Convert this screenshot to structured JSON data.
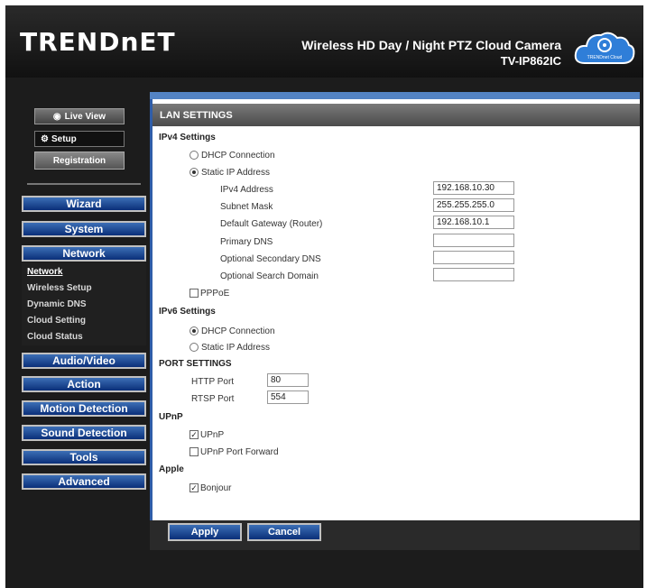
{
  "header": {
    "logo": "TRENDnET",
    "product_title": "Wireless HD Day / Night PTZ Cloud Camera",
    "model": "TV-IP862IC",
    "cloud_label": "TRENDnet Cloud"
  },
  "sidebar": {
    "live_view": "Live View",
    "setup": "Setup",
    "registration": "Registration",
    "nav": [
      "Wizard",
      "System",
      "Network",
      "Audio/Video",
      "Action",
      "Motion Detection",
      "Sound Detection",
      "Tools",
      "Advanced"
    ],
    "network_sub": [
      "Network",
      "Wireless Setup",
      "Dynamic DNS",
      "Cloud Setting",
      "Cloud Status"
    ]
  },
  "lan": {
    "title": "LAN SETTINGS",
    "ipv4_title": "IPv4 Settings",
    "dhcp": "DHCP Connection",
    "static": "Static IP Address",
    "fields": {
      "ipv4_label": "IPv4 Address",
      "ipv4_value": "192.168.10.30",
      "mask_label": "Subnet Mask",
      "mask_value": "255.255.255.0",
      "gateway_label": "Default Gateway (Router)",
      "gateway_value": "192.168.10.1",
      "dns1_label": "Primary DNS",
      "dns1_value": "",
      "dns2_label": "Optional Secondary DNS",
      "dns2_value": "",
      "domain_label": "Optional Search Domain",
      "domain_value": ""
    },
    "pppoe": "PPPoE",
    "ipv6_title": "IPv6 Settings",
    "ipv6_dhcp": "DHCP Connection",
    "ipv6_static": "Static IP Address",
    "port_title": "PORT SETTINGS",
    "http_label": "HTTP Port",
    "http_value": "80",
    "rtsp_label": "RTSP Port",
    "rtsp_value": "554",
    "upnp_title": "UPnP",
    "upnp": "UPnP",
    "upnp_forward": "UPnP Port Forward",
    "apple_title": "Apple",
    "bonjour": "Bonjour"
  },
  "buttons": {
    "apply": "Apply",
    "cancel": "Cancel"
  }
}
